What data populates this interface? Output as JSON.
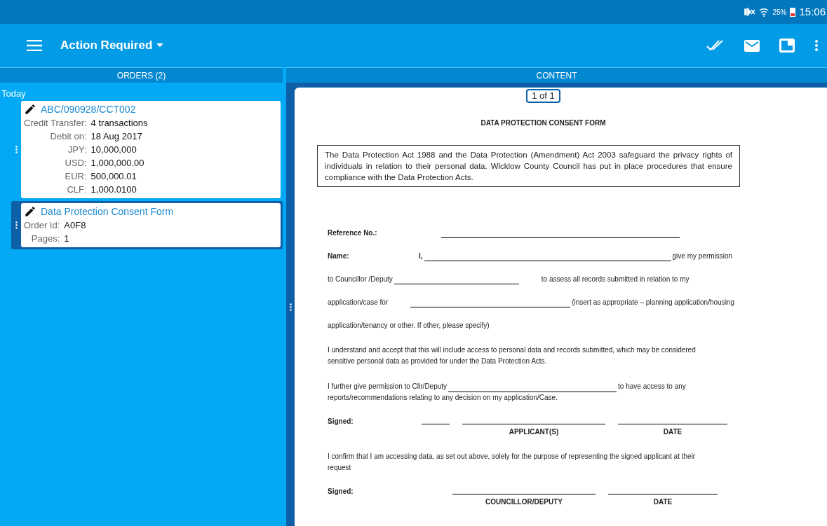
{
  "status_bar": {
    "battery": "25%",
    "time": "15:06"
  },
  "app_bar": {
    "title": "Action Required"
  },
  "orders": {
    "header": "ORDERS (2)",
    "group": "Today",
    "items": [
      {
        "title": "ABC/090928/CCT002",
        "selected": false,
        "fields": [
          {
            "label": "Credit Transfer:",
            "value": "4 transactions"
          },
          {
            "label": "Debit on:",
            "value": "18 Aug 2017"
          },
          {
            "label": "JPY:",
            "value": "10,000,000"
          },
          {
            "label": "USD:",
            "value": "1,000,000.00"
          },
          {
            "label": "EUR:",
            "value": "500,000.01"
          },
          {
            "label": "CLF:",
            "value": "1,000.0100"
          }
        ]
      },
      {
        "title": "Data Protection Consent Form",
        "selected": true,
        "fields": [
          {
            "label": "Order Id:",
            "value": "A0F8"
          },
          {
            "label": "Pages:",
            "value": "1"
          }
        ]
      }
    ]
  },
  "content": {
    "header": "CONTENT",
    "page_indicator": "1 of 1",
    "document": {
      "title": "DATA PROTECTION CONSENT FORM",
      "intro": "The Data Protection Act 1988 and the Data Protection (Amendment) Act 2003 safeguard the privacy rights of individuals in relation to their personal data.  Wicklow County Council has put in place procedures that ensure compliance with the Data Protection Acts.",
      "blocks": [
        {
          "kind": "line",
          "segments": [
            {
              "kind": "label",
              "text": "Reference No.:"
            },
            {
              "kind": "gap"
            },
            {
              "kind": "blank"
            }
          ]
        },
        {
          "kind": "line",
          "segments": [
            {
              "kind": "label",
              "text": "Name:"
            },
            {
              "kind": "text",
              "text": "I,",
              "bold": true
            },
            {
              "kind": "blank"
            },
            {
              "kind": "text",
              "text": "give my permission",
              "bold": false
            }
          ]
        },
        {
          "kind": "line",
          "segments": [
            {
              "kind": "text",
              "text": "to Councillor /Deputy",
              "bold": false
            },
            {
              "kind": "blank"
            },
            {
              "kind": "gap"
            },
            {
              "kind": "text",
              "text": "to assess all records submitted in relation to my",
              "bold": false
            }
          ]
        },
        {
          "kind": "line",
          "segments": [
            {
              "kind": "text",
              "text": "application/case for",
              "bold": false
            },
            {
              "kind": "gap"
            },
            {
              "kind": "blank"
            },
            {
              "kind": "text",
              "text": "(insert as appropriate – planning application/housing",
              "bold": false
            }
          ]
        },
        {
          "kind": "line",
          "segments": [
            {
              "kind": "text",
              "text": "application/tenancy or other. If other, please specify)",
              "bold": false
            }
          ]
        },
        {
          "kind": "paragraph",
          "lines": [
            [
              {
                "kind": "text",
                "text": "I understand and accept that this will include access to personal data and records submitted, which may be considered",
                "bold": false
              }
            ],
            [
              {
                "kind": "text",
                "text": "sensitive personal data as provided for under the Data Protection Acts.",
                "bold": false
              }
            ]
          ]
        },
        {
          "kind": "paragraph",
          "lines": [
            [
              {
                "kind": "text",
                "text": "I further give permission to Cllr/Deputy",
                "bold": false
              },
              {
                "kind": "blank"
              },
              {
                "kind": "text",
                "text": "to have access to any",
                "bold": false
              }
            ],
            [
              {
                "kind": "text",
                "text": "reports/recommendations relating to any decision on my application/Case.",
                "bold": false
              }
            ]
          ]
        },
        {
          "kind": "signature",
          "label": "Signed:",
          "fields": [
            {
              "kind": "blank"
            },
            {
              "kind": "blank",
              "caption": "APPLICANT(S)"
            },
            {
              "kind": "blank",
              "caption": "DATE"
            }
          ]
        },
        {
          "kind": "paragraph",
          "lines": [
            [
              {
                "kind": "text",
                "text": "I confirm that I am accessing data, as set out above, solely for the purpose of representing the signed applicant at their",
                "bold": false
              }
            ],
            [
              {
                "kind": "text",
                "text": "request",
                "bold": false
              }
            ]
          ]
        },
        {
          "kind": "signature",
          "label": "Signed:",
          "fields": [
            {
              "kind": "blank",
              "caption": "COUNCILLOR/DEPUTY"
            },
            {
              "kind": "blank",
              "caption": "DATE"
            }
          ]
        }
      ]
    }
  }
}
